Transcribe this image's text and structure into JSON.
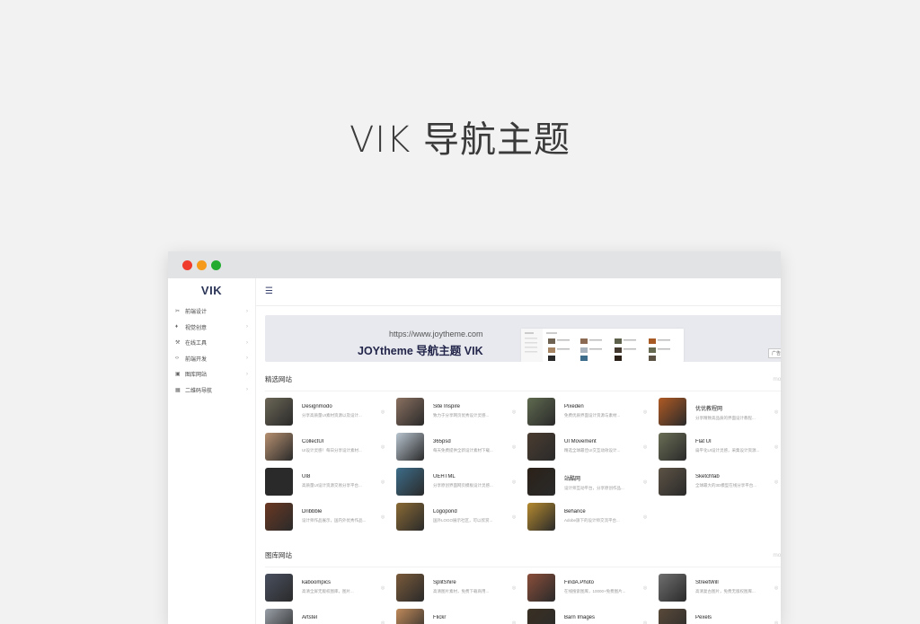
{
  "hero": {
    "title": "VIK 导航主题"
  },
  "window": {
    "dot_colors": [
      "#ef3c2c",
      "#f59a1b",
      "#22ab2f"
    ]
  },
  "sidebar": {
    "logo": "VIK",
    "items": [
      {
        "icon": "scissors-icon",
        "glyph": "✂",
        "label": "前端设计"
      },
      {
        "icon": "fire-icon",
        "glyph": "♦",
        "label": "视觉创意"
      },
      {
        "icon": "tool-icon",
        "glyph": "⚒",
        "label": "在线工具"
      },
      {
        "icon": "code-icon",
        "glyph": "‹›",
        "label": "前端开发"
      },
      {
        "icon": "image-icon",
        "glyph": "▣",
        "label": "图库网站"
      },
      {
        "icon": "qrcode-icon",
        "glyph": "▦",
        "label": "二维码导航"
      }
    ]
  },
  "banner": {
    "url": "https://www.joytheme.com",
    "title": "JOYtheme 导航主题 VIK",
    "ad_label": "广告"
  },
  "sections": [
    {
      "title": "精选网站",
      "more": "more+",
      "cards": [
        {
          "title": "Designmodo",
          "desc": "分享高质量UI素材资源以及设计...",
          "color": "#6b6656"
        },
        {
          "title": "Site Inspire",
          "desc": "致力于分享网页优秀设计灵感...",
          "color": "#8a7060"
        },
        {
          "title": "Pixeden",
          "desc": "免费优质界面设计资源与素材...",
          "color": "#5f6a4f"
        },
        {
          "title": "优优教程网",
          "desc": "分享精致高品质的界面设计教程...",
          "color": "#b05a24"
        },
        {
          "title": "CollectUI",
          "desc": "UI设计灵感！每日分享设计素材...",
          "color": "#b69070"
        },
        {
          "title": "365psd",
          "desc": "每天免费提供全新设计素材下载...",
          "color": "#b8c4cf"
        },
        {
          "title": "UI Movement",
          "desc": "精选全球最佳UI交互动效设计...",
          "color": "#4a3c30"
        },
        {
          "title": "Flat UI",
          "desc": "扁平化UI设计灵感，采集设计资源...",
          "color": "#6a6e55"
        },
        {
          "title": "UI8",
          "desc": "高质量UI设计资源交易分享平台...",
          "color": "#2a2a2a"
        },
        {
          "title": "UEHTML",
          "desc": "分享原创界面网页模板设计灵感...",
          "color": "#3d6d8a"
        },
        {
          "title": "站酷网",
          "desc": "设计师互动平台，分享原创作品...",
          "color": "#2b2118"
        },
        {
          "title": "Sketchfab",
          "desc": "全球最大的3D模型在线分享平台...",
          "color": "#5d5345"
        },
        {
          "title": "Dribbble",
          "desc": "设计师作品展示，国内外优秀作品...",
          "color": "#6a3822"
        },
        {
          "title": "Logopond",
          "desc": "国外LOGO展示社区，可以欣赏...",
          "color": "#8a6a35"
        },
        {
          "title": "Behance",
          "desc": "Adobe旗下的设计师交流平台...",
          "color": "#b58a2f"
        }
      ]
    },
    {
      "title": "图库网站",
      "more": "more+",
      "cards": [
        {
          "title": "kaboompics",
          "desc": "高清全屏无版权图库，图片...",
          "color": "#4a5060"
        },
        {
          "title": "SplitShire",
          "desc": "高清图片素材，免费下载商用...",
          "color": "#7a5a3a"
        },
        {
          "title": "FindA.Photo",
          "desc": "在线搜索图库，10000+免费图片...",
          "color": "#8a4e3a"
        },
        {
          "title": "StreetWill",
          "desc": "高清复古图片，免费无版权图库...",
          "color": "#6f6f6f"
        },
        {
          "title": "Artstel",
          "desc": "",
          "color": "#9aa0a8"
        },
        {
          "title": "Flickr",
          "desc": "",
          "color": "#c08a5a"
        },
        {
          "title": "Barn Images",
          "desc": "",
          "color": "#3a3023"
        },
        {
          "title": "Pexels",
          "desc": "",
          "color": "#5a4a3a"
        }
      ]
    }
  ]
}
